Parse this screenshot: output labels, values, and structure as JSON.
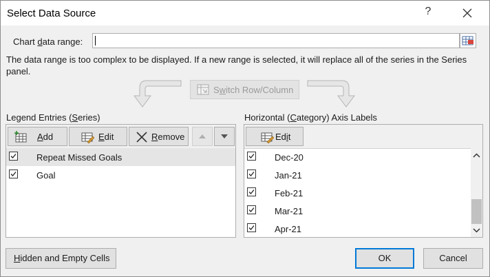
{
  "dialog": {
    "title": "Select Data Source",
    "help_label": "?",
    "close_icon": "close-icon"
  },
  "range": {
    "label_prefix": "Chart ",
    "label_underline": "d",
    "label_suffix": "ata range:",
    "value": "",
    "picker_icon": "range-picker-icon"
  },
  "message": "The data range is too complex to be displayed. If a new range is selected, it will replace all of the series in the Series panel.",
  "switch": {
    "prefix": "S",
    "underline": "w",
    "suffix": "itch Row/Column",
    "icon": "switch-row-column-icon"
  },
  "legend": {
    "label_prefix": "Legend Entries (",
    "label_underline": "S",
    "label_suffix": "eries)",
    "add_underline": "A",
    "add_suffix": "dd",
    "edit_underline": "E",
    "edit_suffix": "dit",
    "remove_underline": "R",
    "remove_suffix": "emove",
    "items": [
      {
        "label": "Repeat Missed Goals",
        "checked": true,
        "selected": true
      },
      {
        "label": "Goal",
        "checked": true,
        "selected": false
      }
    ]
  },
  "axis": {
    "label_prefix": "Horizontal (",
    "label_underline": "C",
    "label_suffix": "ategory) Axis Labels",
    "edit_prefix": "Ed",
    "edit_underline": "i",
    "edit_suffix": "t",
    "items": [
      {
        "label": "Dec-20",
        "checked": true
      },
      {
        "label": "Jan-21",
        "checked": true
      },
      {
        "label": "Feb-21",
        "checked": true
      },
      {
        "label": "Mar-21",
        "checked": true
      },
      {
        "label": "Apr-21",
        "checked": true
      }
    ]
  },
  "footer": {
    "hidden_underline": "H",
    "hidden_suffix": "idden and Empty Cells",
    "ok_label": "OK",
    "cancel_label": "Cancel"
  }
}
